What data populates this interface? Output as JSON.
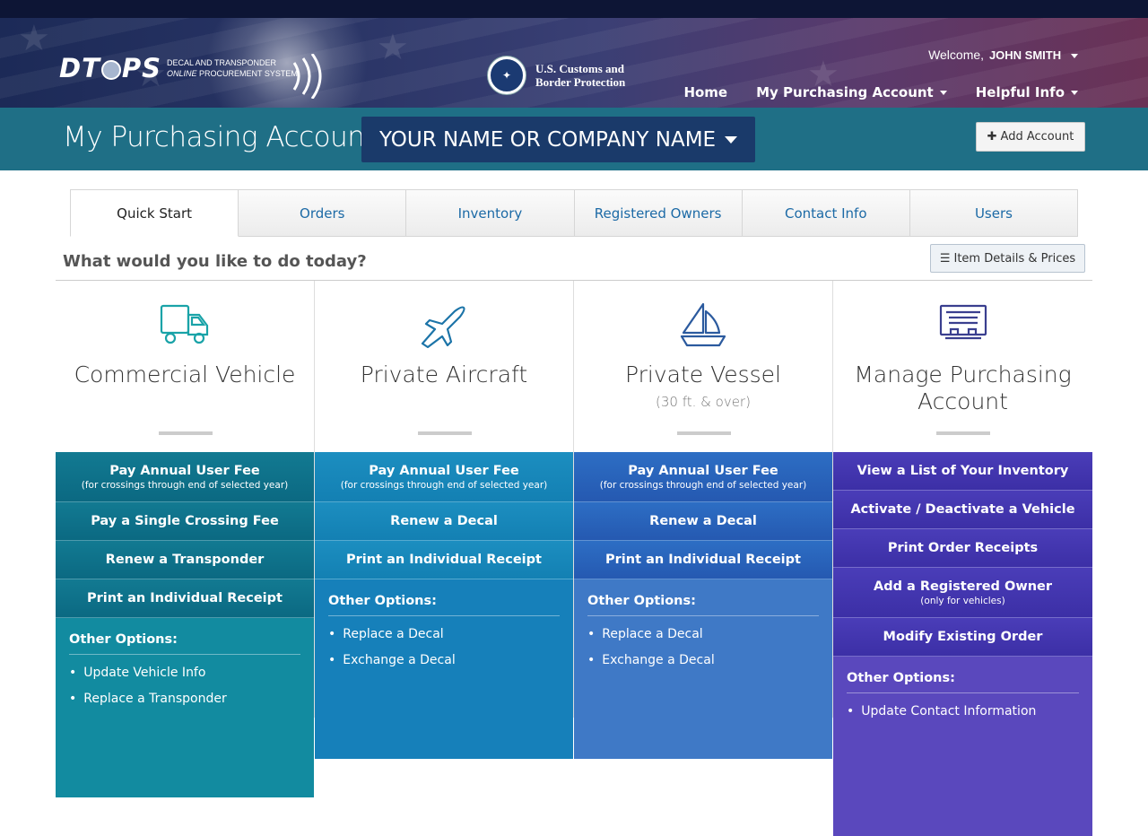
{
  "header": {
    "logo_text": "DTOPS",
    "logo_sub_line1": "DECAL AND TRANSPONDER",
    "logo_sub_line2_italic": "ONLINE",
    "logo_sub_line2_rest": " PROCUREMENT SYSTEM",
    "agency_line1": "U.S. Customs and",
    "agency_line2": "Border Protection",
    "welcome_label": "Welcome,",
    "user_name": "JOHN SMITH",
    "nav": [
      {
        "label": "Home",
        "active": true
      },
      {
        "label": "My Purchasing Account",
        "active": true,
        "dropdown": true
      },
      {
        "label": "Helpful Info",
        "active": false,
        "dropdown": true
      }
    ]
  },
  "account_bar": {
    "title": "My Purchasing Account:",
    "selected_account": "YOUR NAME OR COMPANY NAME",
    "add_button": "Add Account"
  },
  "tabs": [
    "Quick Start",
    "Orders",
    "Inventory",
    "Registered Owners",
    "Contact Info",
    "Users"
  ],
  "active_tab": "Quick Start",
  "main": {
    "question": "What would you like to do today?",
    "item_details_button": "Item Details & Prices"
  },
  "columns": [
    {
      "icon": "truck-icon",
      "title": "Commercial Vehicle",
      "subtitle": "",
      "actions": [
        {
          "label": "Pay Annual User Fee",
          "note": "(for crossings through end of selected year)"
        },
        {
          "label": "Pay a Single Crossing Fee",
          "note": ""
        },
        {
          "label": "Renew a Transponder",
          "note": ""
        },
        {
          "label": "Print an Individual Receipt",
          "note": ""
        }
      ],
      "other_title": "Other Options:",
      "other": [
        "Update Vehicle Info",
        "Replace a Transponder"
      ]
    },
    {
      "icon": "airplane-icon",
      "title": "Private Aircraft",
      "subtitle": "",
      "actions": [
        {
          "label": "Pay Annual User Fee",
          "note": "(for crossings through end of selected year)"
        },
        {
          "label": "Renew a Decal",
          "note": ""
        },
        {
          "label": "Print an Individual Receipt",
          "note": ""
        }
      ],
      "other_title": "Other Options:",
      "other": [
        "Replace a Decal",
        "Exchange a Decal"
      ]
    },
    {
      "icon": "sailboat-icon",
      "title": "Private Vessel",
      "subtitle": "(30 ft. & over)",
      "actions": [
        {
          "label": "Pay Annual User Fee",
          "note": "(for crossings through end of selected year)"
        },
        {
          "label": "Renew a Decal",
          "note": ""
        },
        {
          "label": "Print an Individual Receipt",
          "note": ""
        }
      ],
      "other_title": "Other Options:",
      "other": [
        "Replace a Decal",
        "Exchange a Decal"
      ]
    },
    {
      "icon": "receipt-list-icon",
      "title": "Manage Purchasing Account",
      "subtitle": "",
      "actions": [
        {
          "label": "View a List of Your Inventory",
          "note": ""
        },
        {
          "label": "Activate / Deactivate a Vehicle",
          "note": ""
        },
        {
          "label": "Print Order Receipts",
          "note": ""
        },
        {
          "label": "Add a Registered Owner",
          "note": "(only for vehicles)"
        },
        {
          "label": "Modify Existing Order",
          "note": ""
        }
      ],
      "other_title": "Other Options:",
      "other": [
        "Update Contact Information"
      ]
    }
  ],
  "colors": {
    "header_top": "#0d1535",
    "account_bar": "#1f6f86",
    "account_select": "#1a3a6a",
    "commercial": "#0b6982",
    "aircraft": "#1380b3",
    "vessel": "#2559b1",
    "manage": "#3c2fa6",
    "tab_link": "#1c6aa6",
    "nav_underline": "#3ec4a0"
  }
}
